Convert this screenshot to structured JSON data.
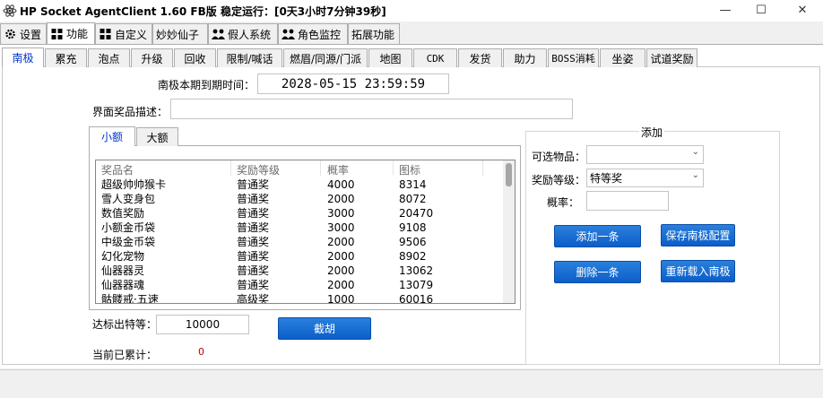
{
  "window": {
    "title": "HP Socket AgentClient 1.60 FB版 稳定运行：[0天3小时7分钟39秒]",
    "minimize_glyph": "—",
    "maximize_glyph": "☐",
    "close_glyph": "✕"
  },
  "top_tabs": [
    {
      "label": "设置",
      "icon": "gear-icon"
    },
    {
      "label": "功能",
      "icon": "grid-icon"
    },
    {
      "label": "自定义",
      "icon": "grid-icon"
    },
    {
      "label": "妙妙仙子"
    },
    {
      "label": "假人系统",
      "icon": "users-icon"
    },
    {
      "label": "角色监控",
      "icon": "users-icon"
    },
    {
      "label": "拓展功能"
    }
  ],
  "func_tabs": [
    "南极",
    "累充",
    "泡点",
    "升级",
    "回收",
    "限制/喊话",
    "燃眉/同源/门派",
    "地图",
    "CDK",
    "发货",
    "助力",
    "BOSS消耗",
    "坐姿",
    "试道奖励"
  ],
  "form": {
    "deadline_label": "南极本期到期时间：",
    "deadline_value": "2028-05-15 23:59:59",
    "desc_label": "界面奖品描述：",
    "desc_value": ""
  },
  "prize_tabs": [
    "小额",
    "大额"
  ],
  "prize_table": {
    "columns": [
      "奖品名",
      "奖励等级",
      "概率",
      "图标"
    ],
    "rows": [
      [
        "超级帅帅猴卡",
        "普通奖",
        "4000",
        "8314"
      ],
      [
        "雪人变身包",
        "普通奖",
        "2000",
        "8072"
      ],
      [
        "数值奖励",
        "普通奖",
        "3000",
        "20470"
      ],
      [
        "小额金币袋",
        "普通奖",
        "3000",
        "9108"
      ],
      [
        "中级金币袋",
        "普通奖",
        "2000",
        "9506"
      ],
      [
        "幻化宠物",
        "普通奖",
        "2000",
        "8902"
      ],
      [
        "仙器器灵",
        "普通奖",
        "2000",
        "13062"
      ],
      [
        "仙器器魂",
        "普通奖",
        "2000",
        "13079"
      ],
      [
        "骷髅戒·五速",
        "高级奖",
        "1000",
        "60016"
      ]
    ]
  },
  "bottom": {
    "threshold_label": "达标出特等：",
    "threshold_value": "10000",
    "cut_button": "截胡",
    "accum_label": "当前已累计：",
    "accum_value": "0"
  },
  "add_group": {
    "title": "添加",
    "item_label": "可选物品：",
    "item_value": "",
    "level_label": "奖励等级：",
    "level_value": "特等奖",
    "prob_label": "概率：",
    "prob_value": "",
    "add_button": "添加一条",
    "save_button": "保存南极配置",
    "delete_button": "删除一条",
    "reload_button": "重新载入南极"
  },
  "colors": {
    "accent": "#0b5ec9",
    "active_tab_text": "#0033cc",
    "accum_value": "#c00000"
  }
}
